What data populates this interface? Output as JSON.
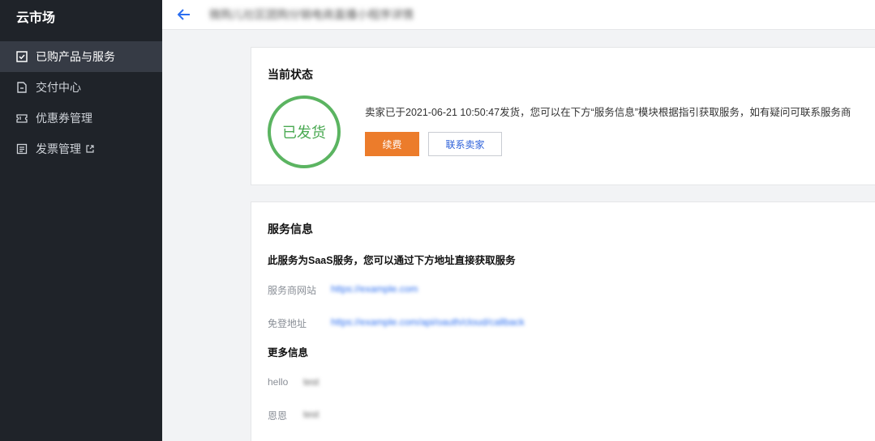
{
  "sidebar": {
    "brand": "云市场",
    "items": [
      {
        "label": "已购产品与服务",
        "icon": "checkbox-icon",
        "active": true
      },
      {
        "label": "交付中心",
        "icon": "doc-icon",
        "active": false
      },
      {
        "label": "优惠券管理",
        "icon": "ticket-icon",
        "active": false
      },
      {
        "label": "发票管理",
        "icon": "invoice-icon",
        "active": false,
        "external": true
      }
    ]
  },
  "header": {
    "title": "微购儿社区团购分销电商直播小程序详情"
  },
  "status_card": {
    "title": "当前状态",
    "status": "已发货",
    "message": "卖家已于2021-06-21 10:50:47发货，您可以在下方“服务信息”模块根据指引获取服务，如有疑问可联系服务商",
    "renew_label": "续费",
    "contact_label": "联系卖家"
  },
  "service_card": {
    "title": "服务信息",
    "desc": "此服务为SaaS服务，您可以通过下方地址直接获取服务",
    "website_label": "服务商网站",
    "website_value": "https://example.com",
    "login_label": "免登地址",
    "login_value": "https://example.com/api/oauth/cloud/callback",
    "more_title": "更多信息",
    "extra": [
      {
        "label": "hello",
        "value": "test"
      },
      {
        "label": "恩恩",
        "value": "test"
      }
    ]
  },
  "colors": {
    "sidebar_bg": "#1f2329",
    "accent_orange": "#ec7c2b",
    "status_green": "#5bb461",
    "link_blue": "#2b6ef0"
  }
}
